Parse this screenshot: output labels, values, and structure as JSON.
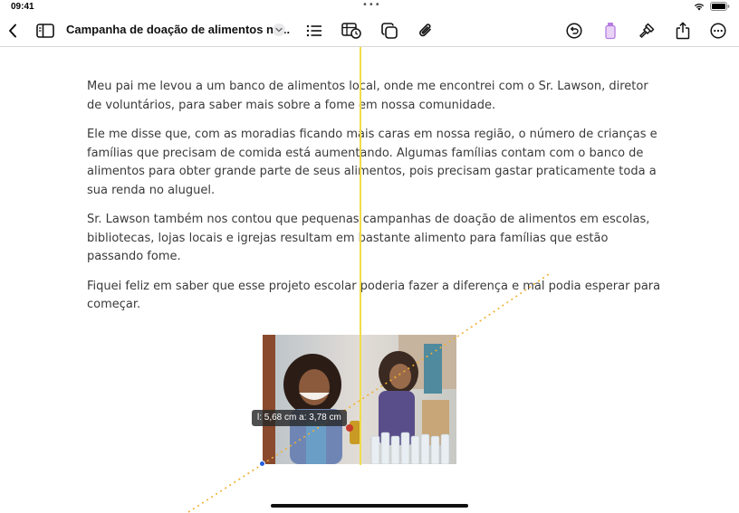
{
  "status_bar": {
    "time": "09:41",
    "center_dots": "•••"
  },
  "toolbar": {
    "back_icon": "chevron-left-icon",
    "sidebar_icon": "sidebar-icon",
    "title": "Campanha de doação de alimentos na...",
    "title_menu_icon": "chevron-down-icon",
    "icons": [
      "list-icon",
      "media-icon",
      "copy-icon",
      "paperclip-icon",
      "undo-icon",
      "pen-icon",
      "format-brush-icon",
      "share-icon",
      "more-icon"
    ]
  },
  "document": {
    "paragraphs": [
      "Meu pai me levou a um banco de alimentos local, onde me encontrei com o Sr. Lawson, diretor de voluntários, para saber mais sobre a fome em nossa comunidade.",
      "Ele me disse que, com as moradias ficando mais caras em nossa região, o número de crianças e famílias que precisam de comida está aumentando. Algumas famílias contam com o banco de alimentos para obter grande parte de seus alimentos, pois precisam gastar praticamente toda a sua renda no aluguel.",
      "Sr. Lawson também nos contou que pequenas campanhas de doação de alimentos em escolas, bibliotecas, lojas locais e igrejas resultam em bastante alimento para famílias que estão passando fome.",
      "Fiquei feliz em saber que esse projeto escolar poderia fazer a diferença e mal podia esperar para começar."
    ]
  },
  "image": {
    "size_label": "l: 5,68 cm  a: 3,78 cm"
  },
  "colors": {
    "guide": "#f0dc4a",
    "handle": "#1f5ee0",
    "pen_accent": "#b57be0"
  }
}
